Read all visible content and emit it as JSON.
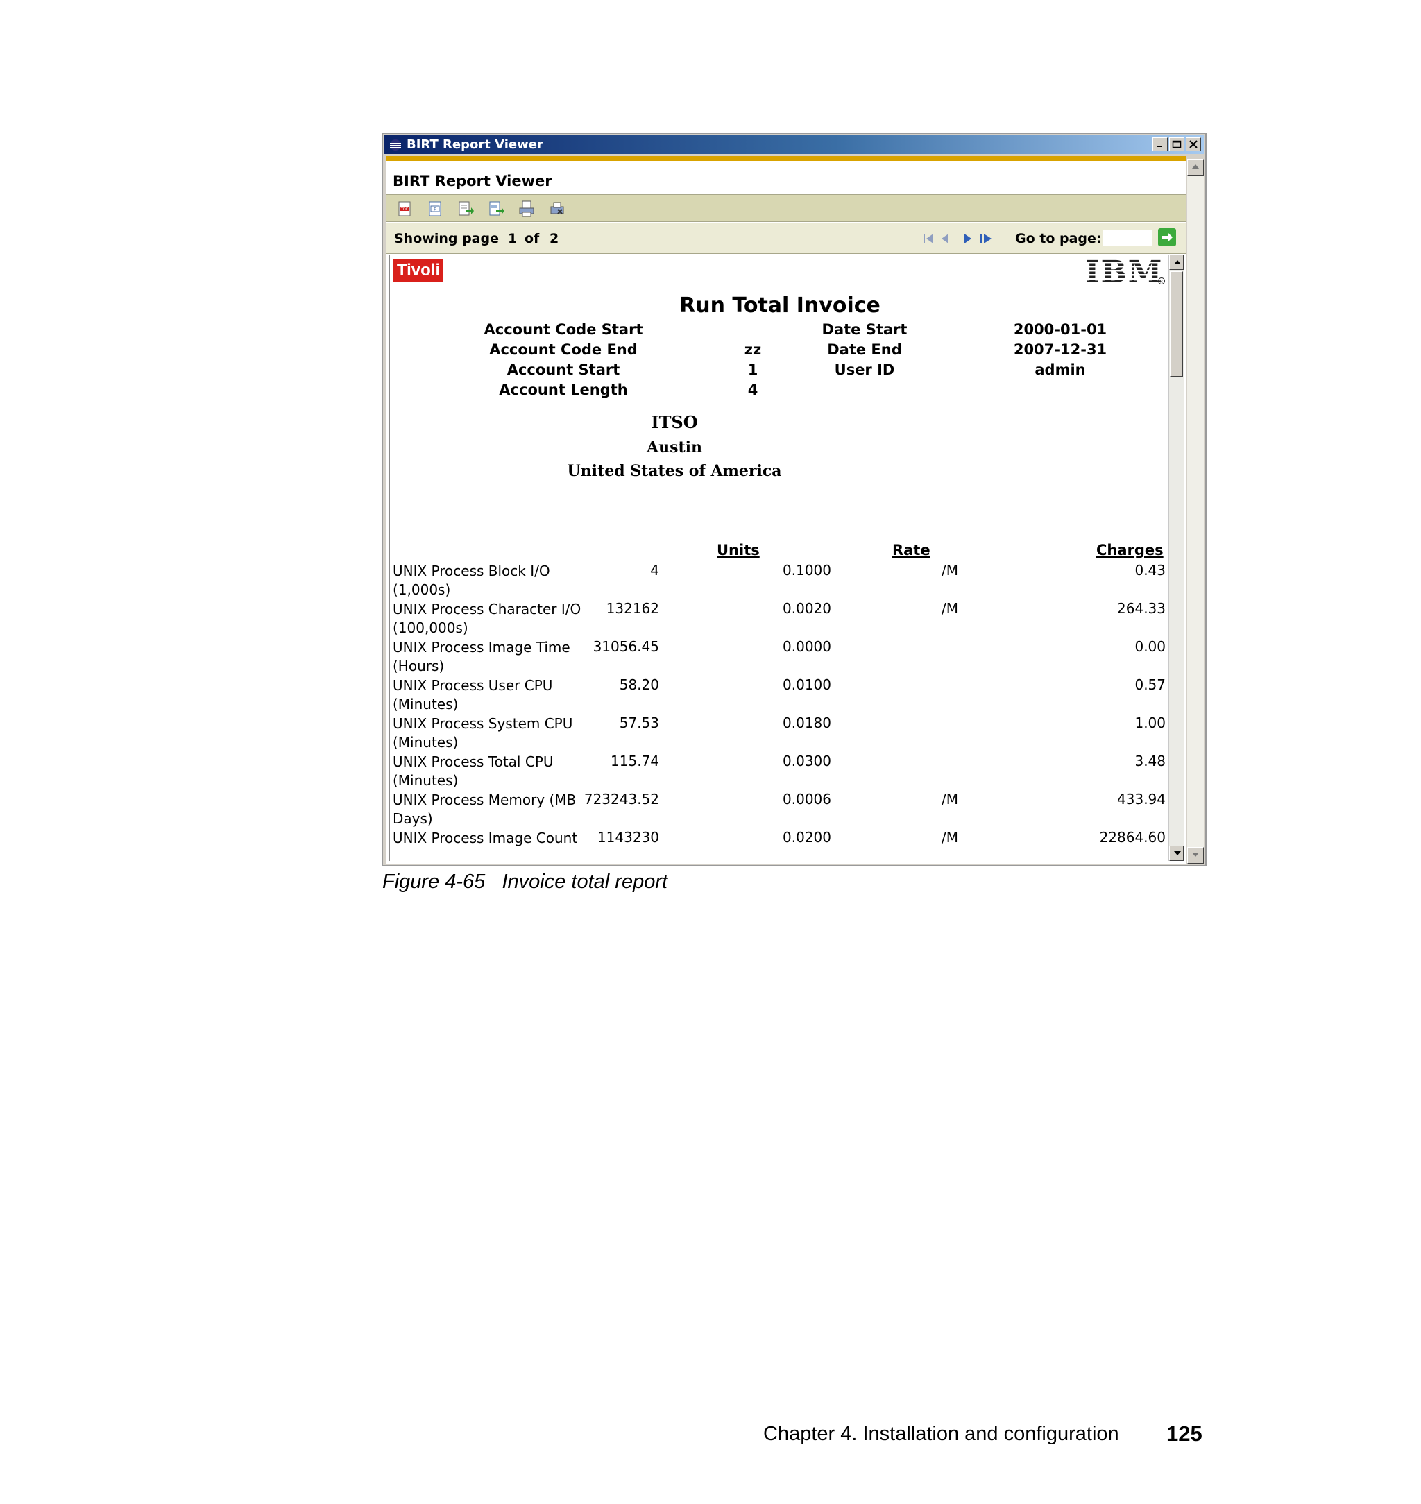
{
  "window": {
    "title": "BIRT Report Viewer",
    "controls": [
      "minimize-icon",
      "maximize-icon",
      "close-icon"
    ]
  },
  "viewer": {
    "heading": "BIRT Report Viewer",
    "toolbar_icons": [
      "toc-icon",
      "parameters-icon",
      "export-data-icon",
      "export-report-icon",
      "print-icon",
      "print-server-icon"
    ],
    "navigation": {
      "showing_label": "Showing page",
      "current_page": "1",
      "of_label": "of",
      "total_pages": "2",
      "goto_label": "Go to page:",
      "goto_value": ""
    }
  },
  "report": {
    "brand_left": "Tivoli",
    "brand_right": "IBM",
    "title": "Run Total Invoice",
    "parameters_left": [
      {
        "label": "Account Code Start",
        "value": ""
      },
      {
        "label": "Account Code End",
        "value": "zz"
      },
      {
        "label": "Account Start",
        "value": "1"
      },
      {
        "label": "Account Length",
        "value": "4"
      }
    ],
    "parameters_right": [
      {
        "label": "Date Start",
        "value": "2000-01-01"
      },
      {
        "label": "Date End",
        "value": "2007-12-31"
      },
      {
        "label": "User ID",
        "value": "admin"
      }
    ],
    "company": {
      "name": "ITSO",
      "city": "Austin",
      "country": "United States of America"
    },
    "columns": {
      "units": "Units",
      "rate": "Rate",
      "charges": "Charges"
    },
    "rows": [
      {
        "desc": "UNIX Process Block I/O (1,000s)",
        "units": "4",
        "rate": "0.1000",
        "per": "/M",
        "charges": "0.43"
      },
      {
        "desc": "UNIX Process Character I/O (100,000s)",
        "units": "132162",
        "rate": "0.0020",
        "per": "/M",
        "charges": "264.33"
      },
      {
        "desc": "UNIX Process Image Time (Hours)",
        "units": "31056.45",
        "rate": "0.0000",
        "per": "",
        "charges": "0.00"
      },
      {
        "desc": "UNIX Process User CPU (Minutes)",
        "units": "58.20",
        "rate": "0.0100",
        "per": "",
        "charges": "0.57"
      },
      {
        "desc": "UNIX Process System CPU (Minutes)",
        "units": "57.53",
        "rate": "0.0180",
        "per": "",
        "charges": "1.00"
      },
      {
        "desc": "UNIX Process Total CPU (Minutes)",
        "units": "115.74",
        "rate": "0.0300",
        "per": "",
        "charges": "3.48"
      },
      {
        "desc": "UNIX Process Memory (MB Days)",
        "units": "723243.52",
        "rate": "0.0006",
        "per": "/M",
        "charges": "433.94"
      },
      {
        "desc": "UNIX Process Image Count",
        "units": "1143230",
        "rate": "0.0200",
        "per": "/M",
        "charges": "22864.60"
      }
    ]
  },
  "caption": "Figure 4-65   Invoice total report",
  "footer": {
    "chapter": "Chapter 4. Installation and configuration",
    "page": "125"
  }
}
